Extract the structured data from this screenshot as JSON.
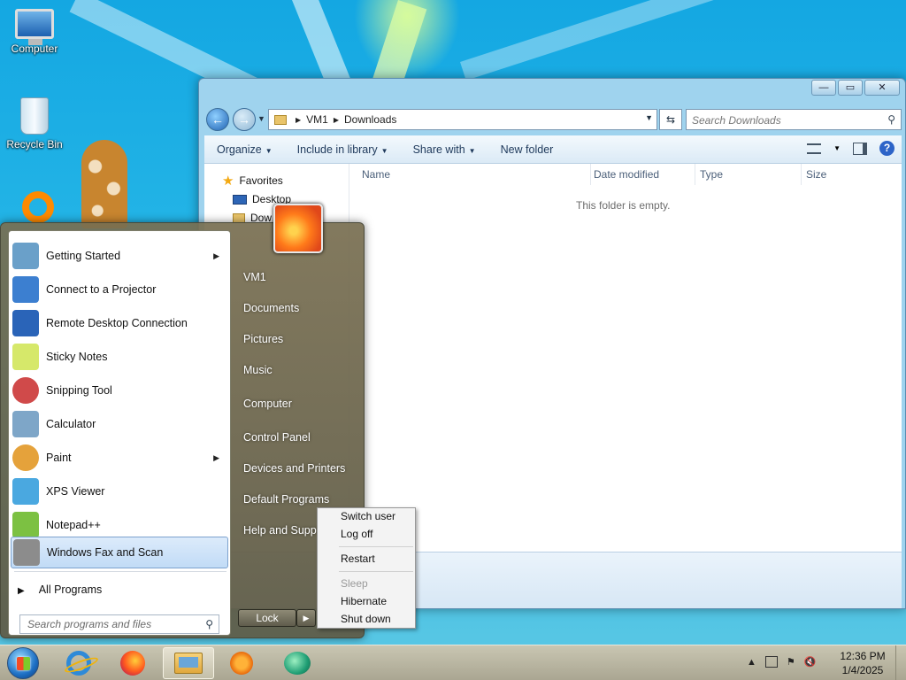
{
  "desktop": {
    "icons": [
      {
        "label": "Computer",
        "icon": "computer-icon"
      },
      {
        "label": "Recycle Bin",
        "icon": "recycle-bin-icon"
      }
    ]
  },
  "explorer": {
    "breadcrumb": [
      "VM1",
      "Downloads"
    ],
    "search_placeholder": "Search Downloads",
    "toolbar": {
      "organize": "Organize",
      "include_in_library": "Include in library",
      "share_with": "Share with",
      "new_folder": "New folder"
    },
    "nav": {
      "favorites": "Favorites",
      "desktop": "Desktop",
      "downloads_partial": "Dow"
    },
    "columns": [
      "Name",
      "Date modified",
      "Type",
      "Size"
    ],
    "empty_message": "This folder is empty.",
    "window_buttons": {
      "minimize": "—",
      "maximize": "▭",
      "close": "✕"
    }
  },
  "start_menu": {
    "programs": [
      {
        "label": "Getting Started",
        "has_submenu": true,
        "icon": "getting-started-icon",
        "color": "#6aa0c9"
      },
      {
        "label": "Connect to a Projector",
        "has_submenu": false,
        "icon": "projector-icon",
        "color": "#3c7fd0"
      },
      {
        "label": "Remote Desktop Connection",
        "has_submenu": false,
        "icon": "remote-desktop-icon",
        "color": "#2a64b8"
      },
      {
        "label": "Sticky Notes",
        "has_submenu": false,
        "icon": "sticky-notes-icon",
        "color": "#d6e86a"
      },
      {
        "label": "Snipping Tool",
        "has_submenu": false,
        "icon": "scissors-icon",
        "color": "#d04a4a"
      },
      {
        "label": "Calculator",
        "has_submenu": false,
        "icon": "calculator-icon",
        "color": "#7ea6c8"
      },
      {
        "label": "Paint",
        "has_submenu": true,
        "icon": "paint-icon",
        "color": "#e5a23b"
      },
      {
        "label": "XPS Viewer",
        "has_submenu": false,
        "icon": "xps-viewer-icon",
        "color": "#4aa8e0"
      },
      {
        "label": "Notepad++",
        "has_submenu": false,
        "icon": "notepad-plus-icon",
        "color": "#7cc142"
      },
      {
        "label": "Windows Fax and Scan",
        "has_submenu": false,
        "icon": "fax-scan-icon",
        "color": "#8c8c8c",
        "selected": true
      }
    ],
    "all_programs": "All Programs",
    "search_placeholder": "Search programs and files",
    "places": [
      "VM1",
      "Documents",
      "Pictures",
      "Music",
      "Computer",
      "Control Panel",
      "Devices and Printers",
      "Default Programs",
      "Help and Support"
    ],
    "lock_label": "Lock"
  },
  "power_menu": {
    "switch_user": "Switch user",
    "log_off": "Log off",
    "restart": "Restart",
    "sleep": "Sleep",
    "hibernate": "Hibernate",
    "shut_down": "Shut down"
  },
  "taskbar": {
    "apps": [
      "internet-explorer",
      "firefox",
      "windows-explorer",
      "media-player",
      "remote-app"
    ],
    "active_app": "windows-explorer",
    "clock_time": "12:36 PM",
    "clock_date": "1/4/2025"
  }
}
